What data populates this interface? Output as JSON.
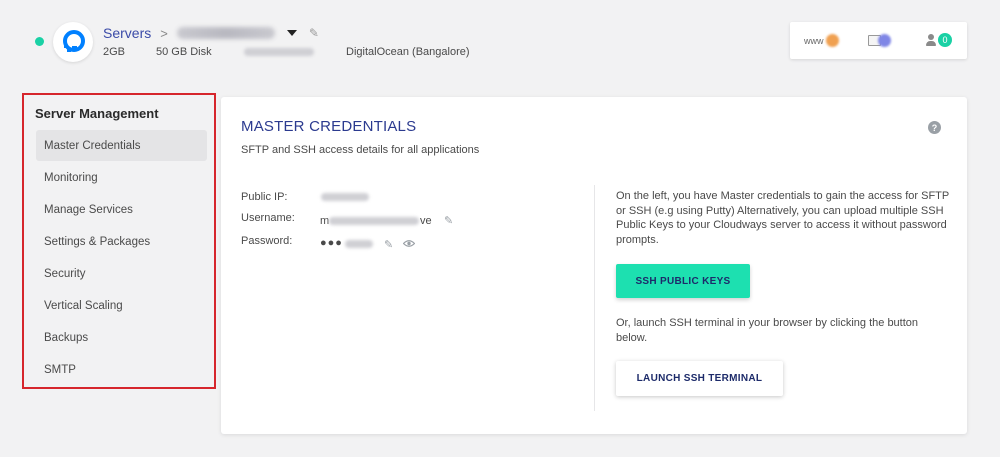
{
  "header": {
    "breadcrumb_root": "Servers",
    "breadcrumb_sep": ">",
    "server_ram": "2GB",
    "server_disk": "50 GB Disk",
    "server_location": "DigitalOcean (Bangalore)",
    "status_color": "#1ad1a5",
    "utils": {
      "www_label": "www",
      "team_count": "0"
    }
  },
  "sidebar": {
    "title": "Server Management",
    "items": [
      {
        "label": "Master Credentials",
        "active": true
      },
      {
        "label": "Monitoring"
      },
      {
        "label": "Manage Services"
      },
      {
        "label": "Settings & Packages"
      },
      {
        "label": "Security"
      },
      {
        "label": "Vertical Scaling"
      },
      {
        "label": "Backups"
      },
      {
        "label": "SMTP"
      }
    ]
  },
  "main": {
    "title": "MASTER CREDENTIALS",
    "subtitle": "SFTP and SSH access details for all applications",
    "help_icon": "?",
    "credentials": {
      "public_ip_label": "Public IP:",
      "username_label": "Username:",
      "username_prefix": "m",
      "username_suffix": "ve",
      "password_label": "Password:",
      "password_mask": "●●●"
    },
    "info_text": "On the left, you have Master credentials to gain the access for SFTP or SSH (e.g using Putty) Alternatively, you can upload multiple SSH Public Keys to your Cloudways server to access it without password prompts.",
    "ssh_keys_button": "SSH PUBLIC KEYS",
    "terminal_text": "Or, launch SSH terminal in your browser by clicking the button below.",
    "terminal_button": "LAUNCH SSH TERMINAL"
  },
  "colors": {
    "accent": "#2b3a8f",
    "primary_button": "#1de0b0",
    "highlight_border": "#d6262c"
  }
}
